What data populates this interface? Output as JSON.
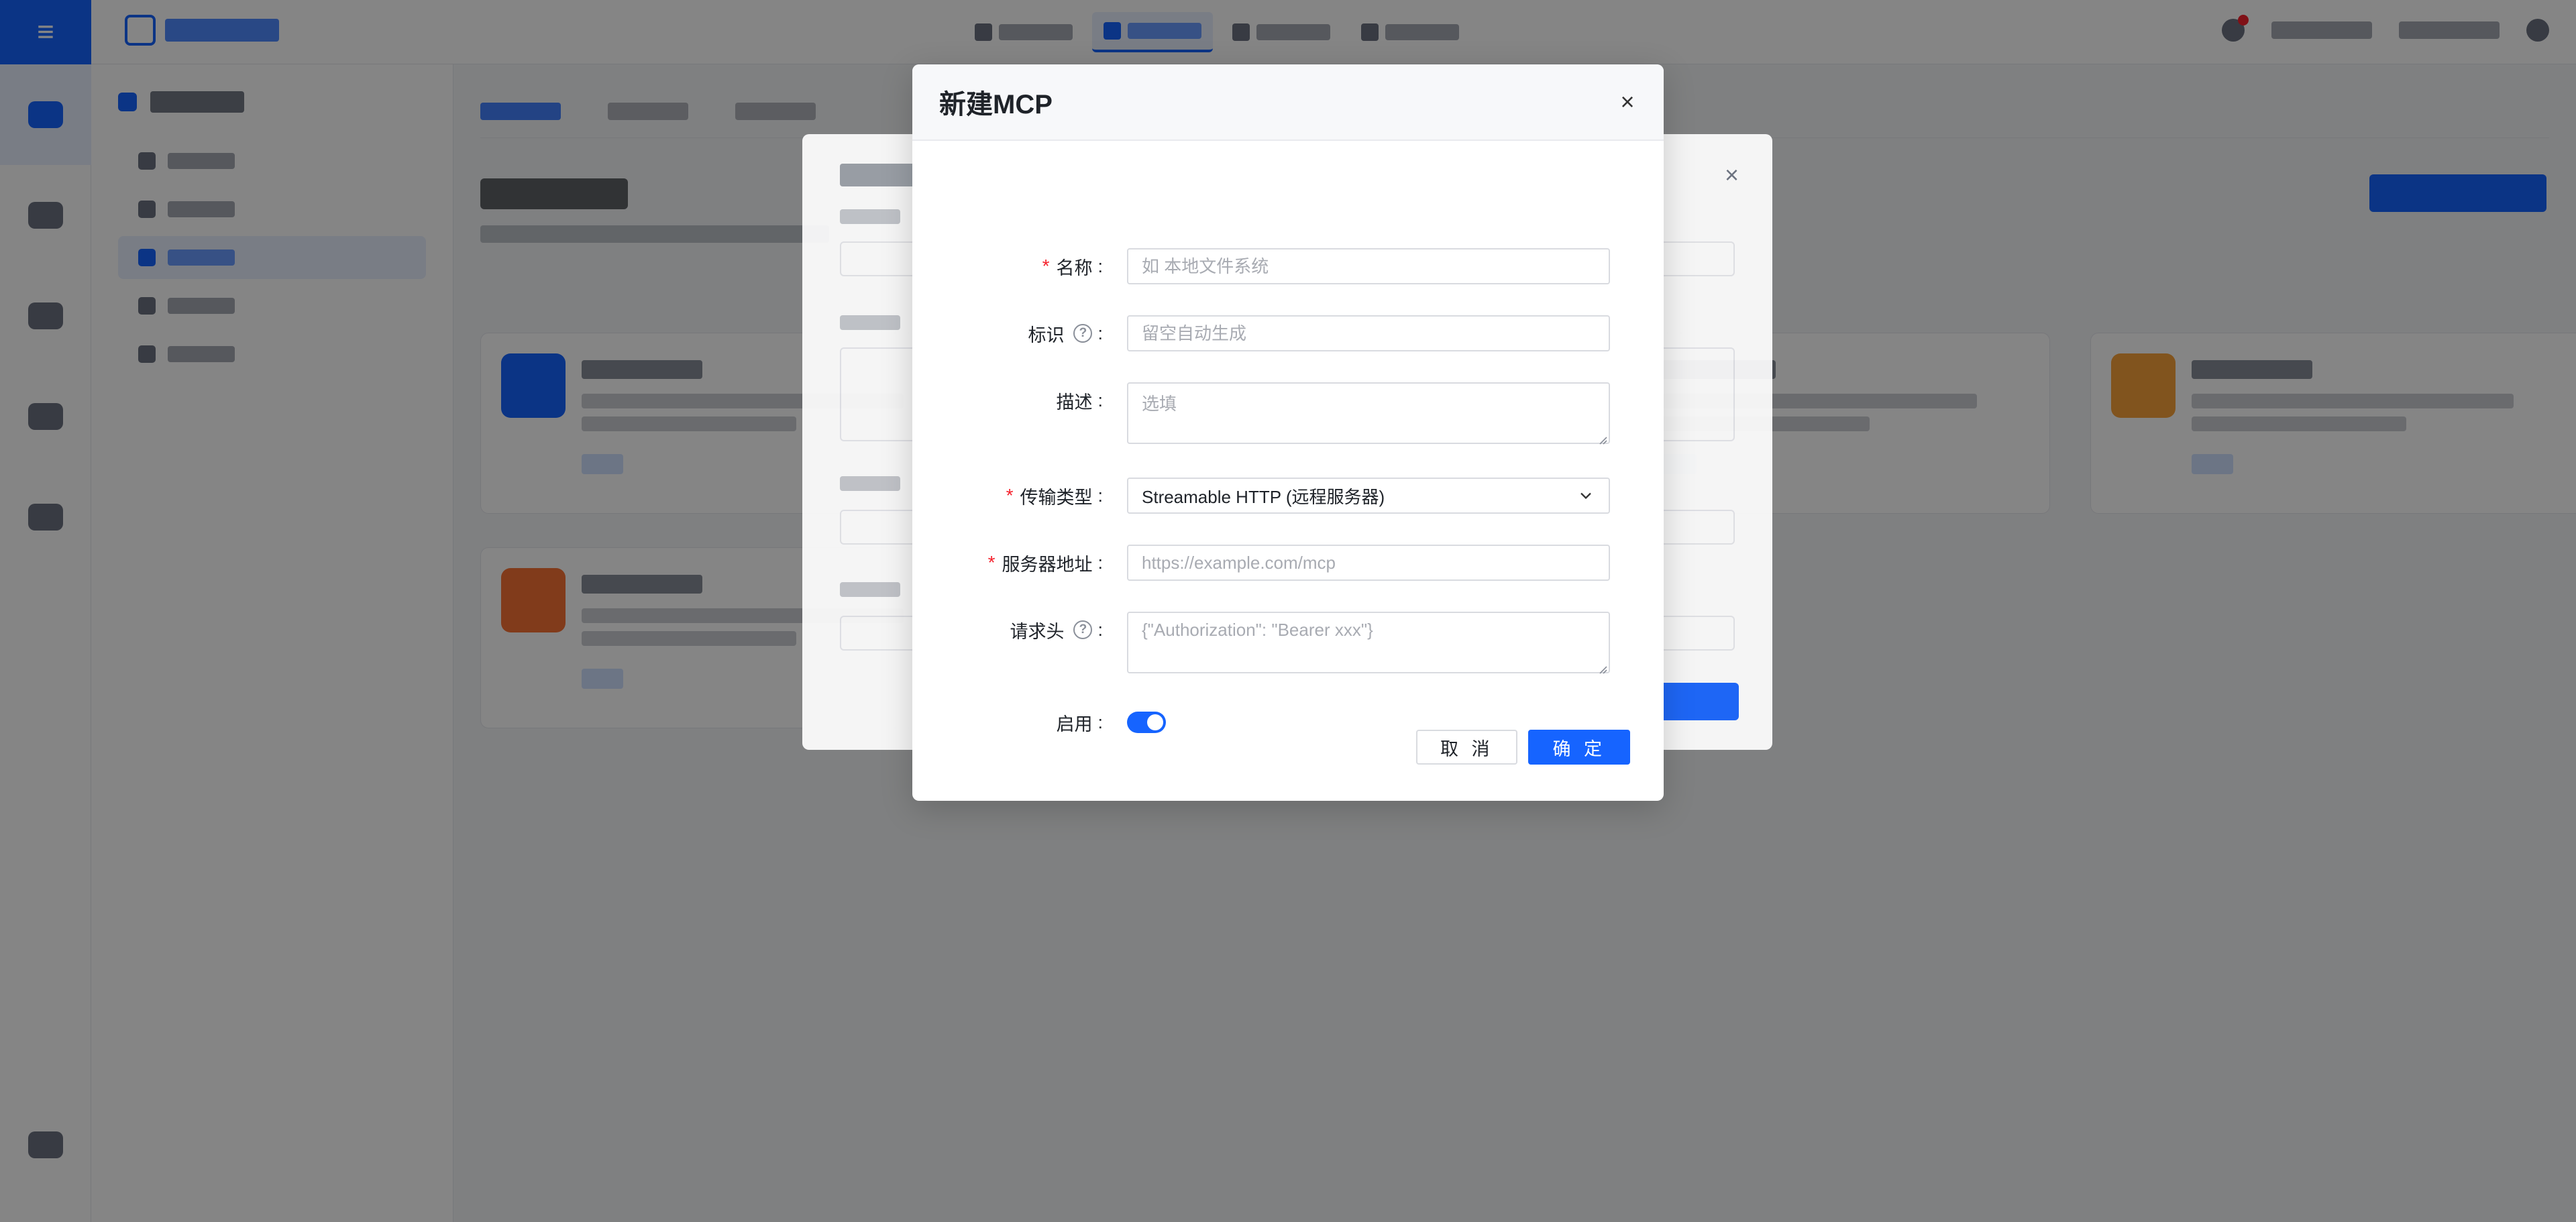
{
  "modal": {
    "title": "新建MCP",
    "close_glyph": "×",
    "fields": {
      "name": {
        "label": "名称",
        "required": true,
        "placeholder": "如 本地文件系统",
        "value": ""
      },
      "identifier": {
        "label": "标识",
        "required": false,
        "placeholder": "留空自动生成",
        "value": "",
        "help": "?"
      },
      "description": {
        "label": "描述",
        "required": false,
        "placeholder": "选填",
        "value": ""
      },
      "transport": {
        "label": "传输类型",
        "required": true,
        "selected": "Streamable HTTP (远程服务器)"
      },
      "server_url": {
        "label": "服务器地址",
        "required": true,
        "placeholder": "https://example.com/mcp",
        "value": ""
      },
      "headers": {
        "label": "请求头",
        "required": false,
        "placeholder": "{\"Authorization\": \"Bearer xxx\"}",
        "value": "",
        "help": "?"
      },
      "enabled": {
        "label": "启用",
        "value": true
      }
    },
    "cancel_label": "取 消",
    "ok_label": "确 定"
  },
  "colors": {
    "primary": "#1664ff",
    "required": "#f5222d",
    "mask": "rgba(0,0,0,0.48)"
  }
}
